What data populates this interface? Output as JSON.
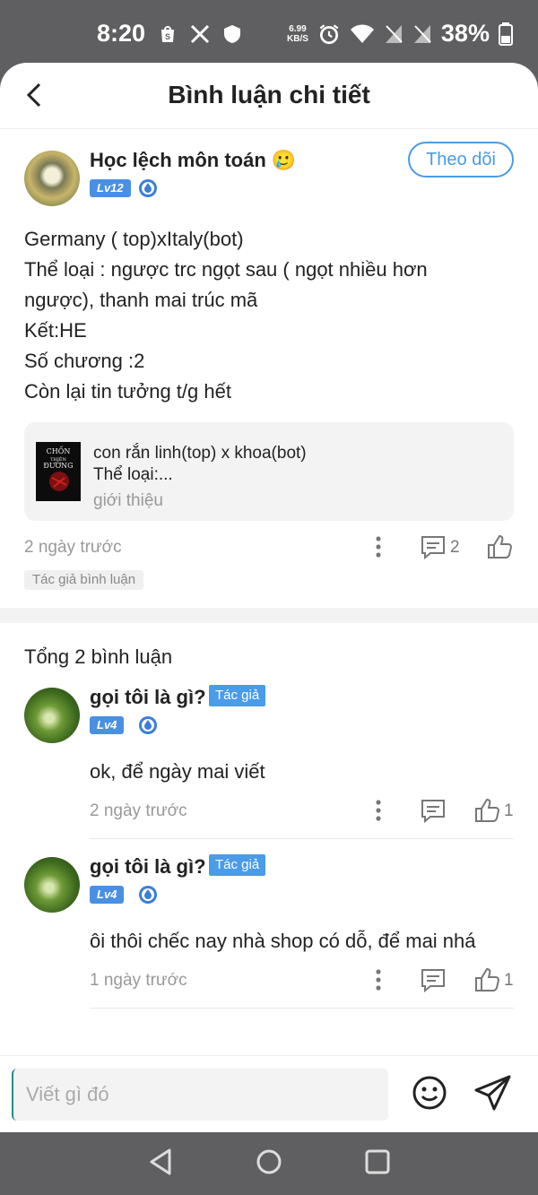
{
  "status_bar": {
    "time": "8:20",
    "speed_value": "6.99",
    "speed_unit": "KB/S",
    "battery": "38%"
  },
  "header": {
    "title": "Bình luận chi tiết"
  },
  "post": {
    "author": "Học lệch môn toán 🥲",
    "level": "Lv12",
    "follow_label": "Theo dõi",
    "body_lines": [
      "Germany ( top)xItaly(bot)",
      "Thể loại : ngược trc ngọt sau ( ngọt nhiều hơn",
      "ngược), thanh mai trúc mã",
      "Kết:HE",
      "Số chương :2",
      "Còn lại tin tưởng t/g hết"
    ],
    "book": {
      "title": "con rắn linh(top) x khoa(bot)",
      "genre": "Thể loại:...",
      "intro_label": "giới thiệu",
      "cover_text": "CHỐN THIÊN ĐƯỜNG"
    },
    "time": "2 ngày trước",
    "comment_count": "2",
    "author_tag": "Tác giả bình luận"
  },
  "replies": {
    "total_label": "Tổng 2 bình luận",
    "items": [
      {
        "name": "gọi tôi là gì?",
        "tag": "Tác giả",
        "level": "Lv4",
        "text": "ok, để ngày mai viết",
        "time": "2 ngày trước",
        "likes": "1"
      },
      {
        "name": "gọi tôi là gì?",
        "tag": "Tác giả",
        "level": "Lv4",
        "text": "ôi thôi chếc nay nhà shop có dỗ, để mai nhá",
        "time": "1 ngày trước",
        "likes": "1"
      }
    ]
  },
  "input": {
    "placeholder": "Viết gì đó"
  },
  "colors": {
    "accent": "#4a9be8",
    "level_badge": "#4a90e2",
    "muted": "#999999"
  }
}
